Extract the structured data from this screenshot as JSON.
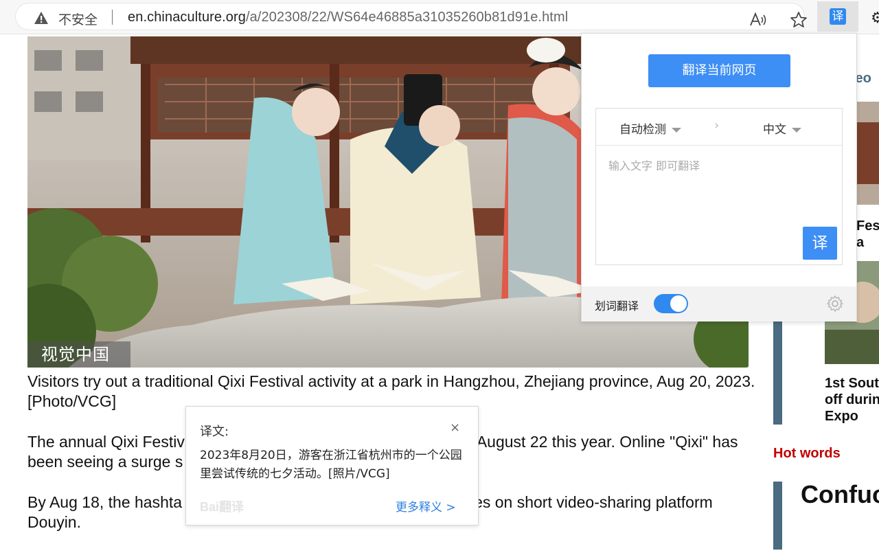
{
  "browser": {
    "security_label": "不安全",
    "url_host": "en.chinaculture.org",
    "url_path": "/a/202308/22/WS64e46885a31035260b81d91e.html",
    "extension_glyph": "译",
    "icons": [
      "warning-icon",
      "read-aloud-icon",
      "star-icon",
      "settings-gear-icon"
    ]
  },
  "article": {
    "photo_watermark": "视觉中国",
    "caption": "Visitors try out a traditional Qixi Festival activity at a park in Hangzhou, Zhejiang province, Aug 20, 2023. [Photo/VCG]",
    "para1_start": "The annual Qixi Festiv",
    "para1_end": "August 22 this year. Online \"Qixi\" has",
    "para1_line2": "been seeing a surge s",
    "para2_start": "By Aug 18, the hashta",
    "para2_end": "es on short video-sharing platform",
    "para2_line2": "Douyin."
  },
  "sidebar": {
    "video_partial": "leo",
    "item1_line1": "Fes",
    "item1_line2": "a",
    "item2_title": [
      "1st Sout",
      "off durin",
      "Expo"
    ],
    "hot_words": "Hot words",
    "hot_word_partial": "Confuc"
  },
  "translator": {
    "translate_page_button": "翻译当前网页",
    "source_lang": "自动检测",
    "target_lang": "中文",
    "input_placeholder": "输入文字 即可翻译",
    "translate_button": "译",
    "selection_translate_label": "划词翻译",
    "selection_translate_enabled": true,
    "accent_color": "#3d8ef5"
  },
  "selection_bubble": {
    "title": "译文:",
    "close": "×",
    "translation": "2023年8月20日，游客在浙江省杭州市的一个公园里尝试传统的七夕活动。[照片/VCG]",
    "logo": "Bai翻译",
    "more_link": "更多释义 >"
  }
}
